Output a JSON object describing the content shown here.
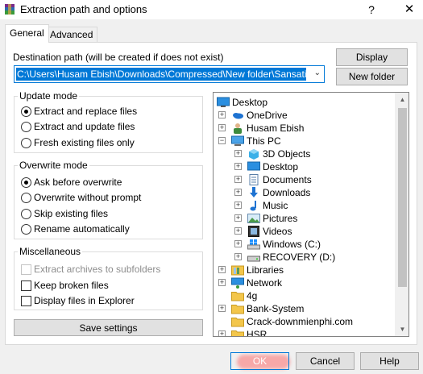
{
  "window": {
    "title": "Extraction path and options",
    "help_symbol": "?",
    "close_symbol": "✕"
  },
  "tabs": [
    {
      "label": "General",
      "active": true
    },
    {
      "label": "Advanced",
      "active": false
    }
  ],
  "destination": {
    "label": "Destination path (will be created if does not exist)",
    "value": "C:\\Users\\Husam Ebish\\Downloads\\Compressed\\New folder\\SansationLight"
  },
  "buttons": {
    "display": "Display",
    "new_folder": "New folder",
    "save_settings": "Save settings",
    "ok": "OK",
    "cancel": "Cancel",
    "help": "Help"
  },
  "update_mode": {
    "title": "Update mode",
    "options": [
      {
        "label": "Extract and replace files",
        "selected": true
      },
      {
        "label": "Extract and update files",
        "selected": false
      },
      {
        "label": "Fresh existing files only",
        "selected": false
      }
    ]
  },
  "overwrite_mode": {
    "title": "Overwrite mode",
    "options": [
      {
        "label": "Ask before overwrite",
        "selected": true
      },
      {
        "label": "Overwrite without prompt",
        "selected": false
      },
      {
        "label": "Skip existing files",
        "selected": false
      },
      {
        "label": "Rename automatically",
        "selected": false
      }
    ]
  },
  "miscellaneous": {
    "title": "Miscellaneous",
    "options": [
      {
        "label": "Extract archives to subfolders",
        "checked": false,
        "disabled": true
      },
      {
        "label": "Keep broken files",
        "checked": false,
        "disabled": false
      },
      {
        "label": "Display files in Explorer",
        "checked": false,
        "disabled": false
      }
    ]
  },
  "tree": {
    "items": [
      {
        "label": "Desktop",
        "icon": "desktop-icon",
        "depth": 0,
        "expander": ""
      },
      {
        "label": "OneDrive",
        "icon": "onedrive-icon",
        "depth": 1,
        "expander": "+"
      },
      {
        "label": "Husam Ebish",
        "icon": "user-icon",
        "depth": 1,
        "expander": "+"
      },
      {
        "label": "This PC",
        "icon": "computer-icon",
        "depth": 1,
        "expander": "−"
      },
      {
        "label": "3D Objects",
        "icon": "3d-objects-icon",
        "depth": 2,
        "expander": "+"
      },
      {
        "label": "Desktop",
        "icon": "desktop-folder-icon",
        "depth": 2,
        "expander": "+"
      },
      {
        "label": "Documents",
        "icon": "documents-icon",
        "depth": 2,
        "expander": "+"
      },
      {
        "label": "Downloads",
        "icon": "downloads-icon",
        "depth": 2,
        "expander": "+"
      },
      {
        "label": "Music",
        "icon": "music-icon",
        "depth": 2,
        "expander": "+"
      },
      {
        "label": "Pictures",
        "icon": "pictures-icon",
        "depth": 2,
        "expander": "+"
      },
      {
        "label": "Videos",
        "icon": "videos-icon",
        "depth": 2,
        "expander": "+"
      },
      {
        "label": "Windows (C:)",
        "icon": "windows-drive-icon",
        "depth": 2,
        "expander": "+"
      },
      {
        "label": "RECOVERY (D:)",
        "icon": "drive-icon",
        "depth": 2,
        "expander": "+"
      },
      {
        "label": "Libraries",
        "icon": "libraries-icon",
        "depth": 1,
        "expander": "+"
      },
      {
        "label": "Network",
        "icon": "network-icon",
        "depth": 1,
        "expander": "+"
      },
      {
        "label": "4g",
        "icon": "folder-icon",
        "depth": 1,
        "expander": ""
      },
      {
        "label": "Bank-System",
        "icon": "folder-icon",
        "depth": 1,
        "expander": "+"
      },
      {
        "label": "Crack-downmienphi.com",
        "icon": "folder-icon",
        "depth": 1,
        "expander": ""
      },
      {
        "label": "HSR",
        "icon": "folder-icon",
        "depth": 1,
        "expander": "+"
      }
    ]
  },
  "colors": {
    "accent": "#0078d7",
    "button_face": "#e1e1e1",
    "ok_highlight": "#ff5050"
  }
}
